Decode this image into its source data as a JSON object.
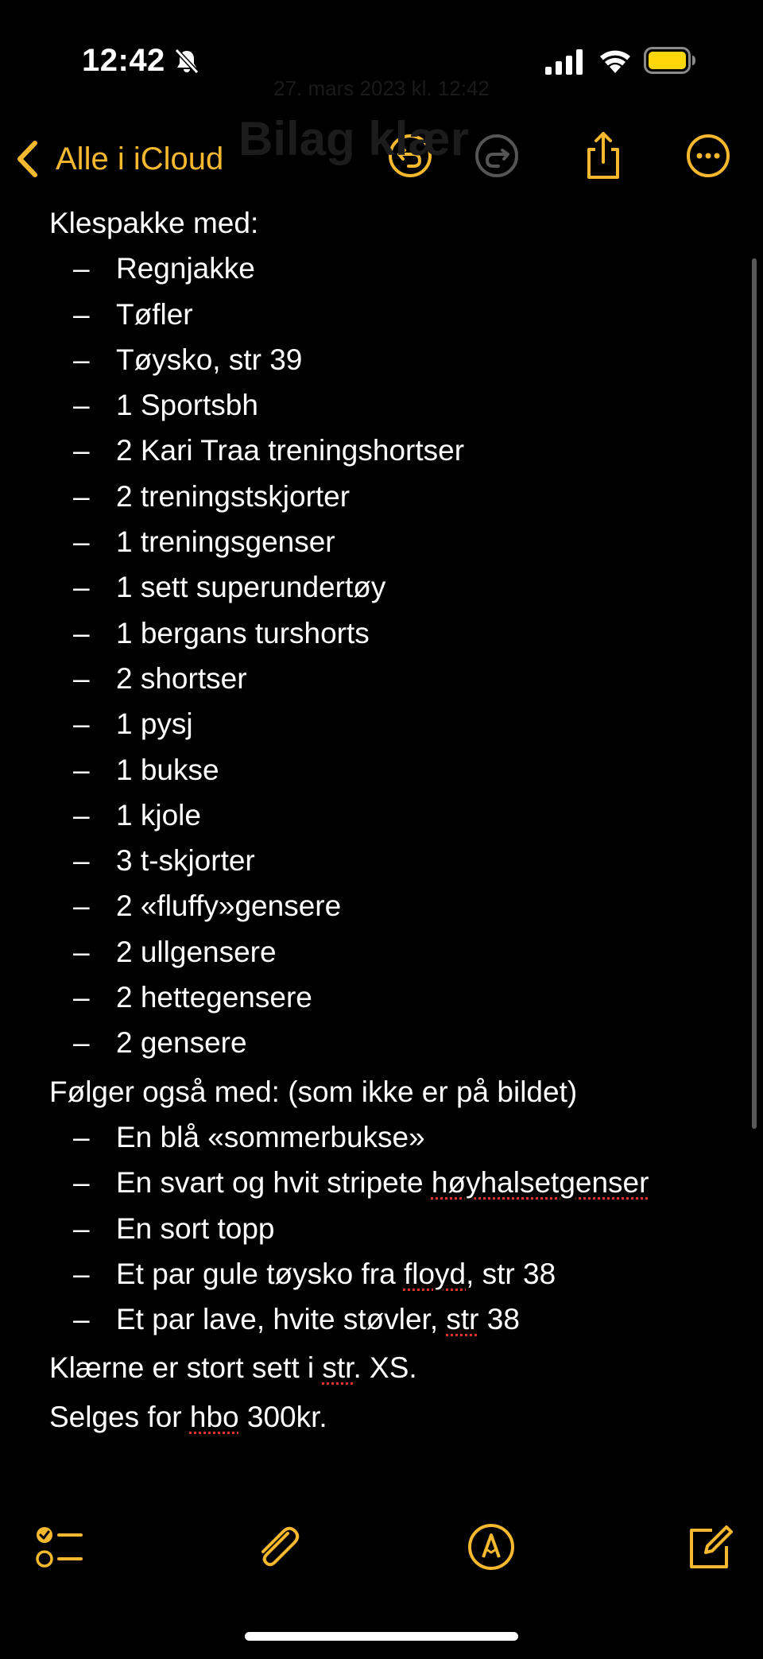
{
  "status_bar": {
    "time": "12:42"
  },
  "nav": {
    "back_label": "Alle i iCloud",
    "faded_date": "27. mars 2023 kl. 12:42",
    "faded_title": "Bilag klær"
  },
  "content": {
    "heading1": "Klespakke med:",
    "items1": [
      "Regnjakke",
      "Tøfler",
      "Tøysko, str 39",
      "1 Sportsbh",
      "2 Kari Traa treningshortser",
      "2 treningstskjorter",
      "1 treningsgenser",
      "1 sett superundertøy",
      "1 bergans turshorts",
      "2 shortser",
      "1 pysj",
      "1 bukse",
      "1 kjole",
      "3 t-skjorter",
      "2 «fluffy»gensere",
      "2 ullgensere",
      "2 hettegensere",
      "2 gensere"
    ],
    "heading2": "Følger også med: (som ikke er på bildet)",
    "items2": [
      {
        "before": "En blå «sommerbukse»",
        "spell": "",
        "after": ""
      },
      {
        "before": "En svart og hvit stripete ",
        "spell": "høyhalsetgenser",
        "after": ""
      },
      {
        "before": "En sort topp",
        "spell": "",
        "after": ""
      },
      {
        "before": "Et par gule tøysko fra ",
        "spell": "floyd",
        "after": ", str 38"
      },
      {
        "before": "Et par lave, hvite støvler, ",
        "spell": "str",
        "after": " 38"
      }
    ],
    "line3": {
      "before": "Klærne er stort sett i ",
      "spell": "str",
      "after": ". XS."
    },
    "line4": {
      "before": "Selges for ",
      "spell": "hbo",
      "after": " 300kr."
    }
  },
  "colors": {
    "accent": "#f5b82e",
    "background": "#000000",
    "text": "#ffffff",
    "spellcheck": "#e0332c",
    "disabled_icon": "#555555"
  },
  "icons": {
    "status": [
      "bell-slash-icon",
      "cellular-signal-icon",
      "wifi-icon",
      "battery-icon"
    ],
    "nav": [
      "chevron-left-icon",
      "undo-icon",
      "redo-icon",
      "share-icon",
      "more-icon"
    ],
    "toolbar": [
      "checklist-icon",
      "paperclip-icon",
      "markup-icon",
      "compose-icon"
    ]
  }
}
